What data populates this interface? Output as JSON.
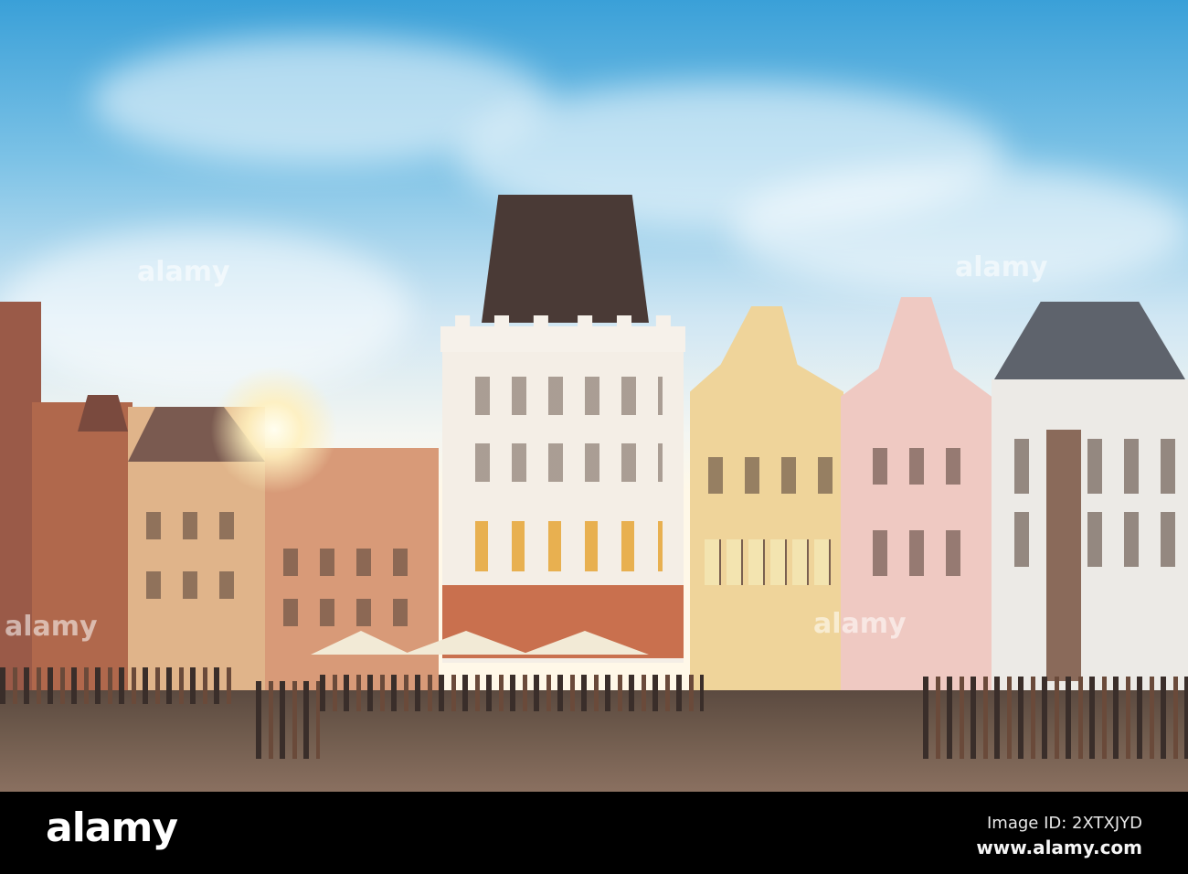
{
  "watermark": {
    "text": "alamy"
  },
  "footer": {
    "logo": "alamy",
    "image_id": "Image ID: 2XTXJYD",
    "url": "www.alamy.com"
  }
}
